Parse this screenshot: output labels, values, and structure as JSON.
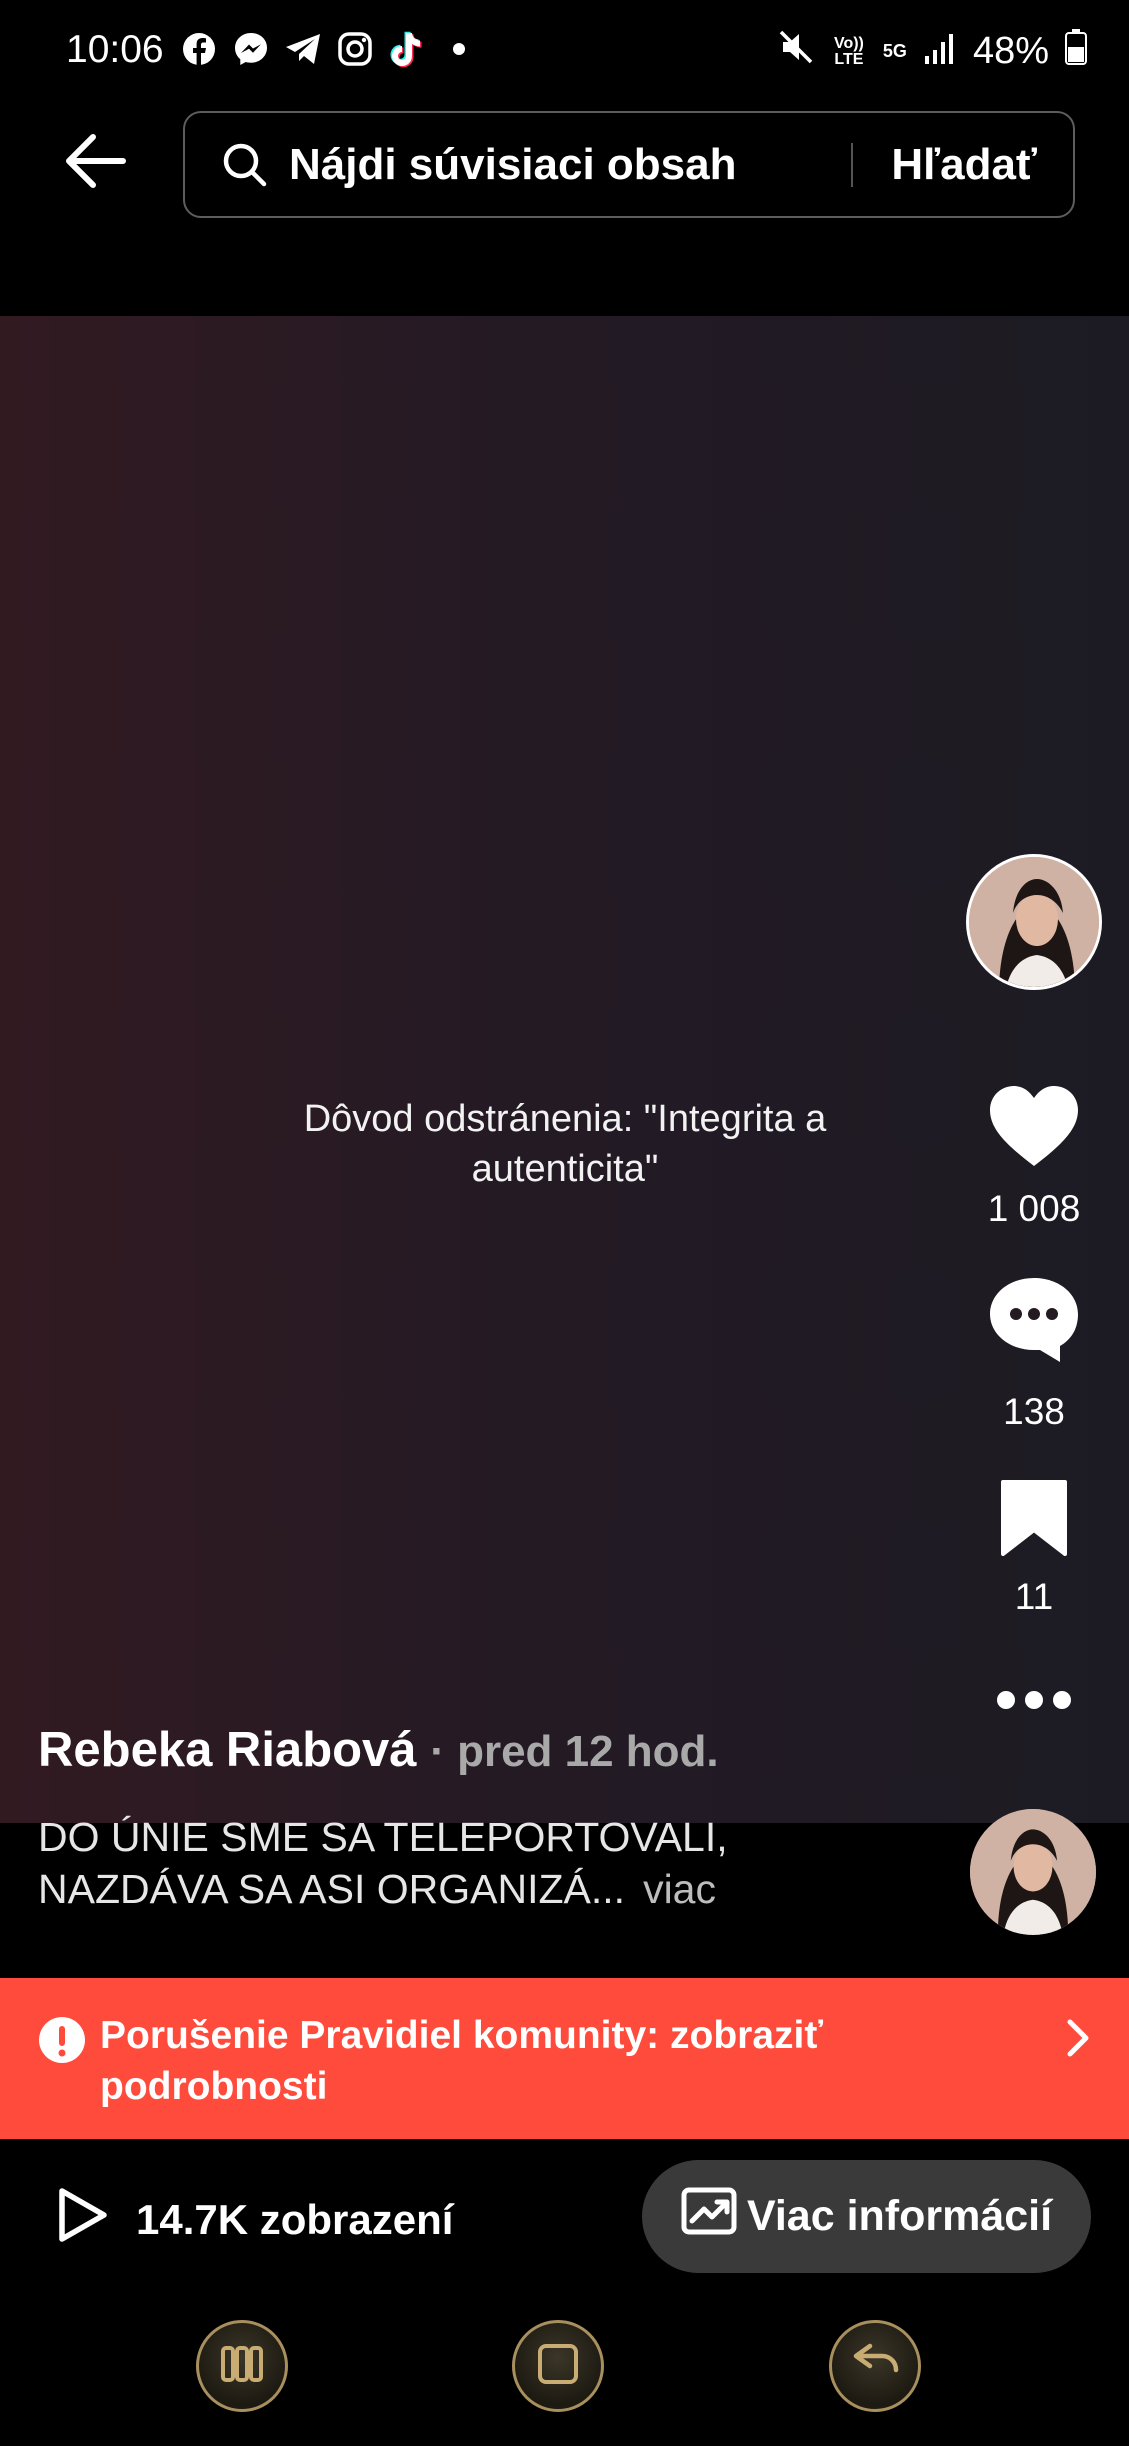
{
  "status_bar": {
    "time": "10:06",
    "app_icons": [
      "facebook-icon",
      "messenger-icon",
      "telegram-icon",
      "instagram-icon",
      "tiktok-icon",
      "dot-icon"
    ],
    "network_labels": {
      "volte": "Vo)) LTE",
      "fiveg": "5G"
    },
    "battery": "48%"
  },
  "search": {
    "placeholder": "Nájdi súvisiaci obsah",
    "submit_label": "Hľadať"
  },
  "video": {
    "removal_reason": "Dôvod odstránenia: \"Integrita a autenticita\""
  },
  "actions": {
    "likes": "1 008",
    "comments": "138",
    "saves": "11"
  },
  "post": {
    "author": "Rebeka Riabová",
    "time": "· pred 12 hod.",
    "caption": "DO ÚNIE SME SA TELEPORTOVALI, NAZDÁVA SA ASI ORGANIZÁ...",
    "more_label": "viac"
  },
  "violation": {
    "text": "Porušenie Pravidiel komunity: zobraziť podrobnosti"
  },
  "footer": {
    "views": "14.7K zobrazení",
    "more_info_label": "Viac informácií"
  },
  "colors": {
    "background": "#000000",
    "violation_banner": "#fe4b3c",
    "more_info_button": "#3a3a3a",
    "nav_button_ring": "#a88f5e"
  }
}
